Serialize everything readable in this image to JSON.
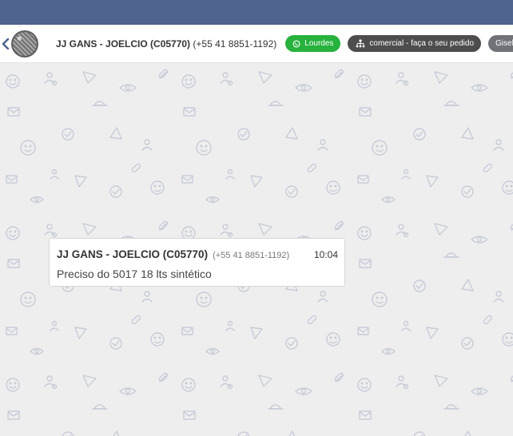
{
  "header": {
    "back_icon": "chevron-left-icon",
    "avatar_icon": "contact-avatar",
    "contact_name": "JJ GANS - JOELCIO (C05770)",
    "contact_phone": "(+55 41 8851-1192)",
    "tags": [
      {
        "label": "Lourdes",
        "icon": "whatsapp-icon",
        "color": "#26b23d"
      },
      {
        "label": "comercial - faça o seu pedido",
        "icon": "org-chart-icon",
        "color": "#4d4d4d"
      },
      {
        "label": "Gisele",
        "color": "#6f7378"
      }
    ]
  },
  "colors": {
    "topbar": "#4f6590",
    "chat_background": "#eeeeee",
    "pattern": "#c8ccd8"
  },
  "messages": [
    {
      "sender": "JJ GANS - JOELCIO (C05770)",
      "phone": "(+55 41 8851-1192)",
      "time": "10:04",
      "text": "Preciso do 5017 18 lts sintético"
    }
  ]
}
